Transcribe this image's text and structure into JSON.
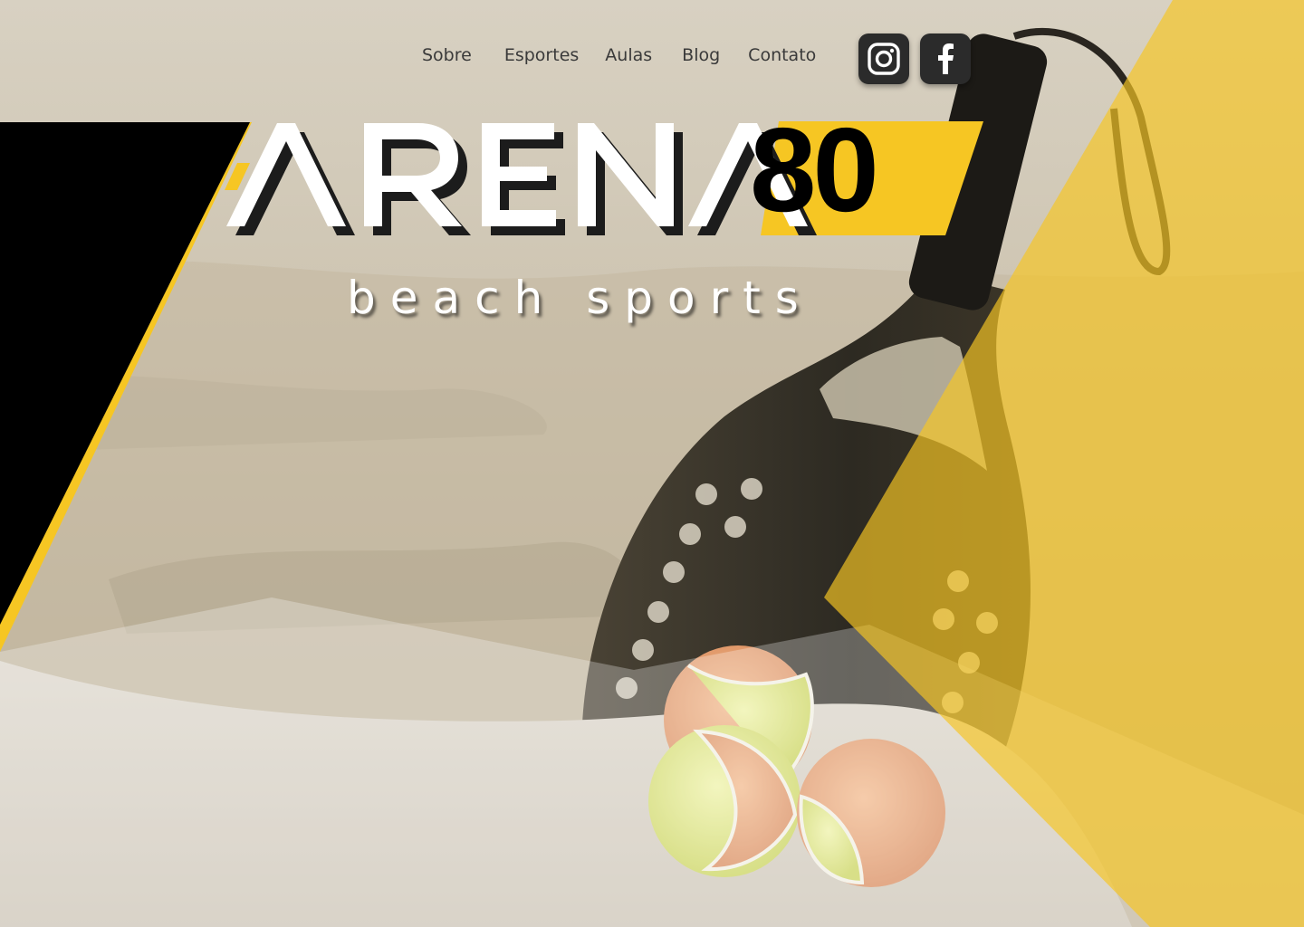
{
  "nav": {
    "links": [
      "Sobre",
      "Esportes",
      "Aulas",
      "Blog",
      "Contato"
    ]
  },
  "social": {
    "instagram_icon": "instagram-icon",
    "facebook_icon": "facebook-icon"
  },
  "logo": {
    "word": "ARENA",
    "number": "80",
    "subtitle": "beach sports"
  },
  "colors": {
    "accent": "#f6c623",
    "dark": "#000000",
    "sand": "#cfc6b4",
    "text": "#ffffff"
  }
}
